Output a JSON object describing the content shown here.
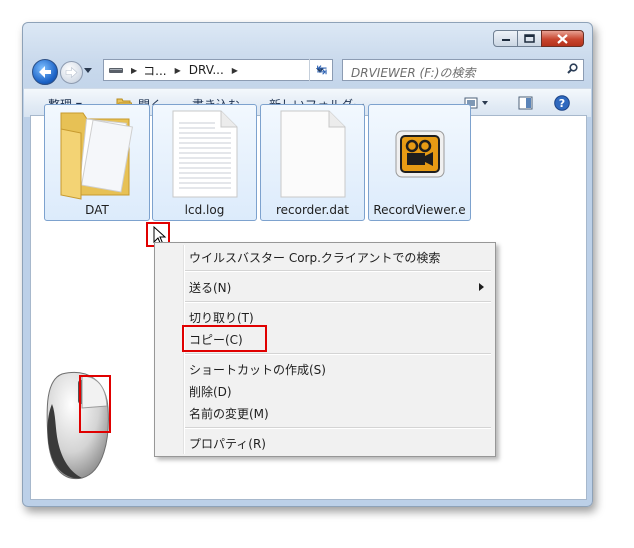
{
  "address": {
    "seg1": "コ...",
    "seg2": "DRV..."
  },
  "search": {
    "placeholder": "DRVIEWER (F:)の検索"
  },
  "toolbar": {
    "organize": "整理 ▾",
    "open": "開く",
    "burn": "書き込む",
    "new_folder": "新しいフォルダー"
  },
  "files": [
    {
      "name": "DAT",
      "icon": "folder-icon"
    },
    {
      "name": "lcd.log",
      "icon": "text-file-icon"
    },
    {
      "name": "recorder.dat",
      "icon": "blank-file-icon"
    },
    {
      "name": "RecordViewer.e",
      "icon": "app-camera-icon"
    }
  ],
  "context_menu": {
    "items": [
      "ウイルスバスター Corp.クライアントでの検索",
      "送る(N)",
      "切り取り(T)",
      "コピー(C)",
      "ショートカットの作成(S)",
      "削除(D)",
      "名前の変更(M)",
      "プロパティ(R)"
    ]
  },
  "colors": {
    "highlight_box": "#e00000",
    "selection_border": "#7da2ce"
  }
}
